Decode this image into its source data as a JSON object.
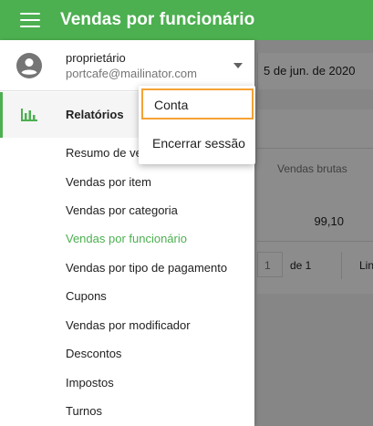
{
  "app": {
    "title": "Vendas por funcionário"
  },
  "account": {
    "name": "proprietário",
    "email": "portcafe@mailinator.com"
  },
  "account_menu": {
    "items": [
      "Conta",
      "Encerrar sessão"
    ]
  },
  "nav": {
    "section": "Relatórios",
    "sub_items": [
      "Resumo de vendas",
      "Vendas por item",
      "Vendas por categoria",
      "Vendas por funcionário",
      "Vendas por tipo de pagamento",
      "Cupons",
      "Vendas por modificador",
      "Descontos",
      "Impostos",
      "Turnos"
    ],
    "active_index": 3
  },
  "background": {
    "date_text": "5 de jun. de 2020",
    "column_header": "Vendas brutas",
    "value": "99,10",
    "pager_page": "1",
    "pager_of": "de 1",
    "pager_more": "Lin"
  },
  "colors": {
    "accent": "#4caf50",
    "focus_outline": "#f4a233"
  }
}
